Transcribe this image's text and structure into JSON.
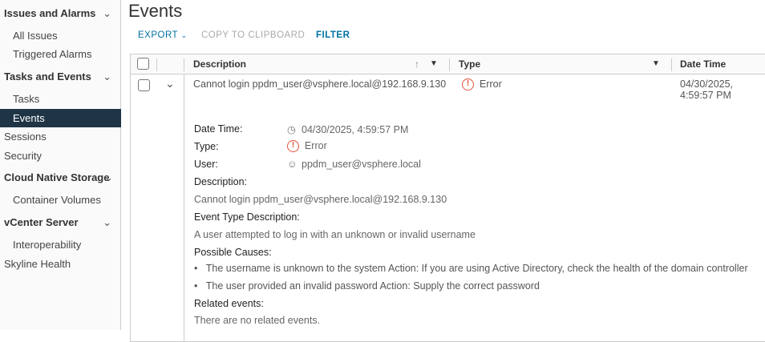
{
  "sidebar": {
    "sections": [
      {
        "label": "Issues and Alarms",
        "items": [
          "All Issues",
          "Triggered Alarms"
        ]
      },
      {
        "label": "Tasks and Events",
        "items": [
          "Tasks",
          "Events"
        ]
      },
      {
        "label": "Cloud Native Storage",
        "items": [
          "Container Volumes"
        ]
      },
      {
        "label": "vCenter Server",
        "items": [
          "Interoperability"
        ]
      }
    ],
    "top_items": [
      "Sessions",
      "Security",
      "Skyline Health"
    ],
    "selected": "Events"
  },
  "page": {
    "title": "Events"
  },
  "toolbar": {
    "export": "EXPORT",
    "copy": "COPY TO CLIPBOARD",
    "filter": "FILTER"
  },
  "table": {
    "columns": [
      "Description",
      "Type",
      "Date Time"
    ],
    "row": {
      "description": "Cannot login ppdm_user@vsphere.local@192.168.9.130",
      "type": "Error",
      "datetime": "04/30/2025, 4:59:57 PM"
    }
  },
  "detail": {
    "labels": {
      "datetime": "Date Time:",
      "type": "Type:",
      "user": "User:",
      "description": "Description:",
      "event_type": "Event Type Description:",
      "causes": "Possible Causes:",
      "related": "Related events:"
    },
    "datetime": "04/30/2025, 4:59:57 PM",
    "type": "Error",
    "user": "ppdm_user@vsphere.local",
    "description": "Cannot login ppdm_user@vsphere.local@192.168.9.130",
    "event_type": "A user attempted to log in with an unknown or invalid username",
    "causes": [
      "The username is unknown to the system Action: If you are using Active Directory, check the health of the domain controller",
      "The user provided an invalid password Action: Supply the correct password"
    ],
    "related": "There are no related events."
  },
  "colors": {
    "accent": "#0072a3",
    "selected": "#1f3546",
    "error": "#e2523c"
  }
}
